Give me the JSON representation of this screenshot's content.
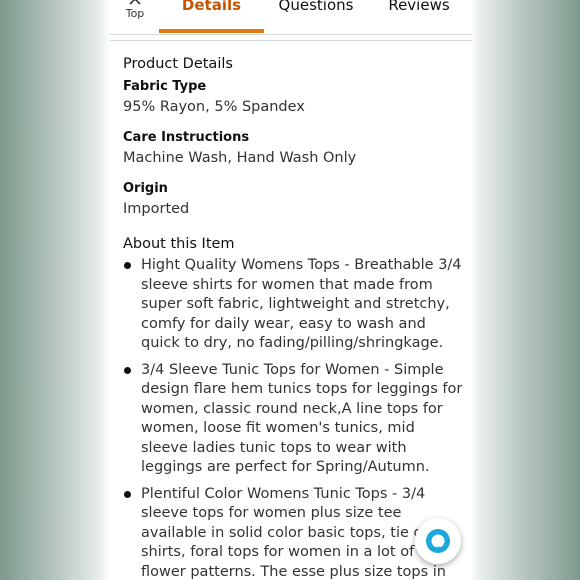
{
  "tabs": {
    "top_label": "Top",
    "items": [
      {
        "label": "Details",
        "active": true
      },
      {
        "label": "Questions",
        "active": false
      },
      {
        "label": "Reviews",
        "active": false
      }
    ]
  },
  "product_details": {
    "heading": "Product Details",
    "attributes": [
      {
        "name": "Fabric Type",
        "value": "95% Rayon, 5% Spandex"
      },
      {
        "name": "Care Instructions",
        "value": "Machine Wash, Hand Wash Only"
      },
      {
        "name": "Origin",
        "value": "Imported"
      }
    ]
  },
  "about": {
    "heading": "About this Item",
    "bullets": [
      "Hight Quality Womens Tops - Breathable 3/4 sleeve shirts for women that made from super soft fabric, lightweight and stretchy, comfy for daily wear, easy to wash and quick to dry, no fading/pilling/shringkage.",
      "3/4 Sleeve Tunic Tops for Women - Simple design flare hem tunics tops for leggings for women, classic round neck,A line tops for women, loose fit women's tunics, mid sleeve ladies tunic tops to wear with leggings are perfect for Spring/Autumn.",
      "Plentiful Color Womens Tunic Tops - 3/4 sleeve tops for women plus size tee available in solid color basic tops, tie dye shirts, foral tops for women in a lot of flower patterns. The esse plus size tops in your wardrobe."
    ]
  },
  "colors": {
    "active_tab": "#c45500",
    "underline": "#e47911",
    "alexa": "#1ca8dd"
  },
  "icons": {
    "top": "chevron-up-icon",
    "assistant": "alexa-icon"
  }
}
